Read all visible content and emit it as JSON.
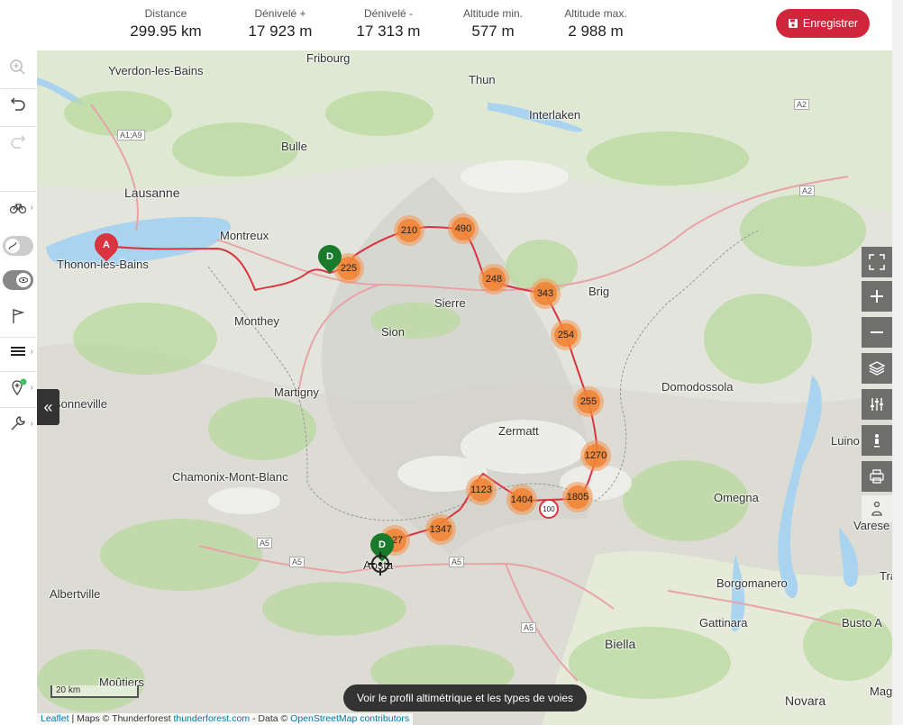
{
  "stats": [
    {
      "label": "Distance",
      "value": "299.95 km"
    },
    {
      "label": "Dénivelé +",
      "value": "17 923 m"
    },
    {
      "label": "Dénivelé -",
      "value": "17 313 m"
    },
    {
      "label": "Altitude min.",
      "value": "577 m"
    },
    {
      "label": "Altitude max.",
      "value": "2 988 m"
    }
  ],
  "save_button": {
    "label": "Enregistrer",
    "color": "#d0253a"
  },
  "left_toolbar": {
    "icons": [
      "zoom-to-fit-icon",
      "undo-icon",
      "redo-icon",
      "bike-icon",
      "route-toggle",
      "visibility-toggle",
      "flag-icon",
      "layers-menu-icon",
      "add-waypoint-icon",
      "wrench-icon"
    ]
  },
  "map": {
    "places": [
      {
        "name": "Yverdon-les-Bains"
      },
      {
        "name": "Fribourg"
      },
      {
        "name": "Thun"
      },
      {
        "name": "Interlaken"
      },
      {
        "name": "Bulle"
      },
      {
        "name": "Lausanne"
      },
      {
        "name": "Montreux"
      },
      {
        "name": "Thonon-les-Bains"
      },
      {
        "name": "Monthey"
      },
      {
        "name": "Sierre"
      },
      {
        "name": "Sion"
      },
      {
        "name": "Brig"
      },
      {
        "name": "Martigny"
      },
      {
        "name": "Bonneville"
      },
      {
        "name": "Zermatt"
      },
      {
        "name": "Domodossola"
      },
      {
        "name": "Chamonix-Mont-Blanc"
      },
      {
        "name": "Luino"
      },
      {
        "name": "Omegna"
      },
      {
        "name": "Aosta"
      },
      {
        "name": "Borgomanero"
      },
      {
        "name": "Albertville"
      },
      {
        "name": "Gattinara"
      },
      {
        "name": "Busto A"
      },
      {
        "name": "Biella"
      },
      {
        "name": "Moûtiers"
      },
      {
        "name": "Novara"
      },
      {
        "name": "Mag"
      },
      {
        "name": "Varese"
      },
      {
        "name": "Tra"
      }
    ],
    "road_shields": [
      "A1;A9",
      "A2",
      "A2",
      "A5",
      "A5",
      "A5",
      "A5"
    ],
    "speed_sign": "100",
    "clusters": [
      "210",
      "490",
      "225",
      "248",
      "343",
      "254",
      "255",
      "1270",
      "1805",
      "1404",
      "1123",
      "1347",
      "127"
    ],
    "markers": [
      {
        "label": "A",
        "color": "red"
      },
      {
        "label": "D",
        "color": "green"
      },
      {
        "label": "D",
        "color": "green"
      }
    ],
    "route_color": "#d9343f",
    "scale_label": "20 km",
    "profile_button": "Voir le profil altimétrique et les types de voies",
    "attribution": {
      "leaflet": "Leaflet",
      "maps": " | Maps © Thunderforest ",
      "tf_link": "thunderforest.com",
      "data": " - Data © ",
      "osm_link": "OpenStreetMap contributors"
    }
  },
  "right_toolbar": {
    "icons": [
      "fullscreen-icon",
      "zoom-in-icon",
      "zoom-out-icon",
      "layers-icon",
      "filter-icon",
      "street-view-icon",
      "print-icon",
      "person-icon"
    ]
  }
}
